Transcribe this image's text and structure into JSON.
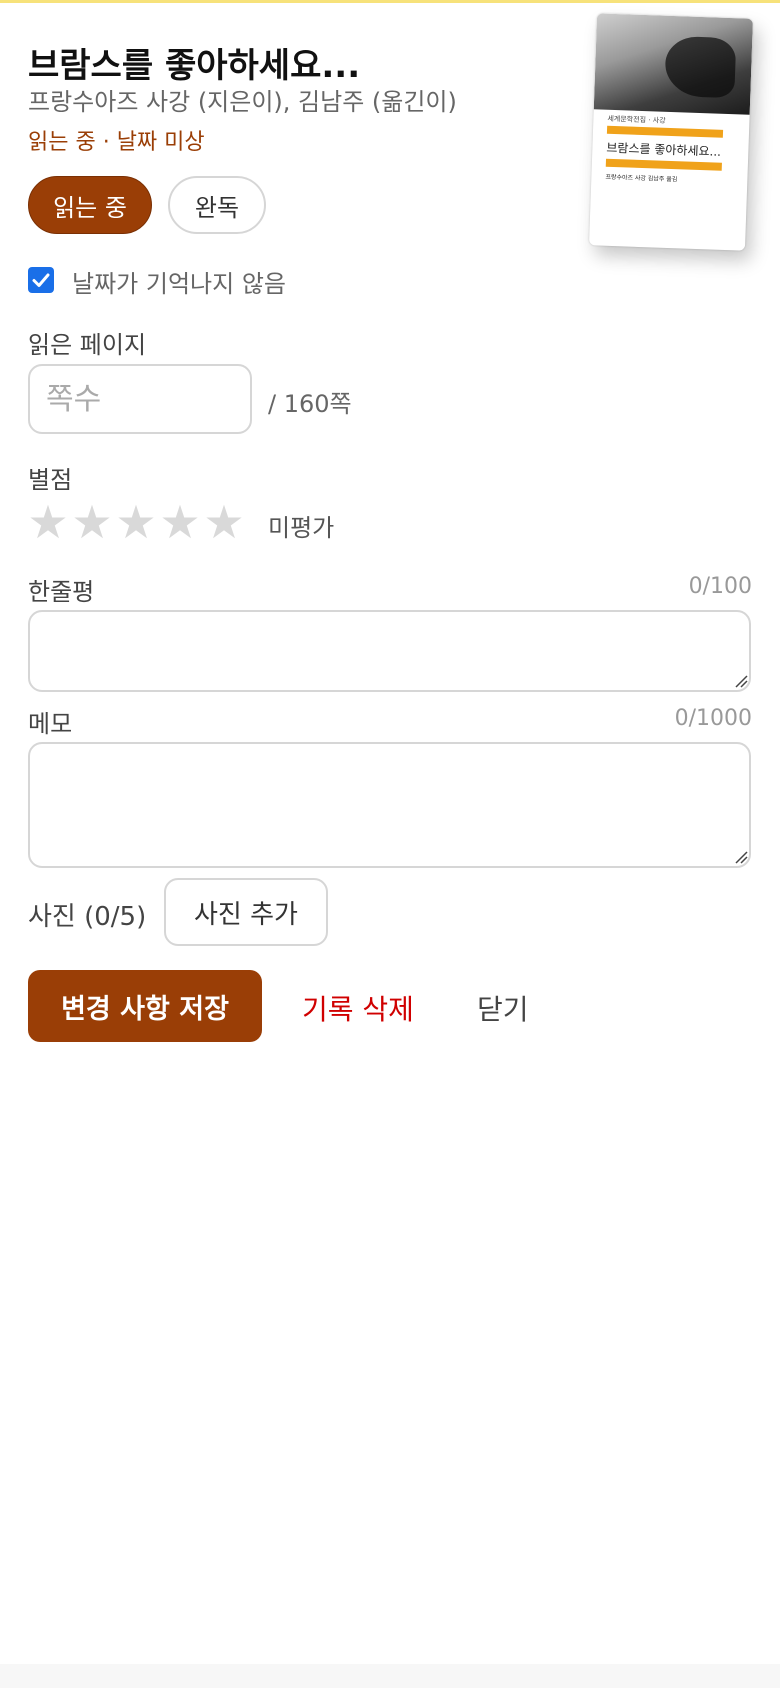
{
  "book": {
    "title": "브람스를 좋아하세요...",
    "authors": "프랑수아즈 사강 (지은이), 김남주 (옮긴이)",
    "status_line": "읽는 중 · 날짜 미상"
  },
  "cover": {
    "title": "브람스를 좋아하세요...",
    "series": "세계문학전집 · 사강",
    "author": "프랑수아즈 사강  김남주 옮김"
  },
  "status_buttons": {
    "reading": "읽는 중",
    "done": "완독",
    "selected": "reading"
  },
  "no_date": {
    "checked": true,
    "label": "날짜가 기억나지 않음"
  },
  "pages": {
    "label": "읽은 페이지",
    "placeholder": "쪽수",
    "value": "",
    "total": "/ 160쪽"
  },
  "rating": {
    "label": "별점",
    "value": 0,
    "max": 5,
    "text": "미평가"
  },
  "one_line_review": {
    "label": "한줄평",
    "counter": "0/100",
    "value": ""
  },
  "memo": {
    "label": "메모",
    "counter": "0/1000",
    "value": ""
  },
  "photos": {
    "label": "사진 (0/5)",
    "add_label": "사진 추가"
  },
  "actions": {
    "save": "변경 사항 저장",
    "delete": "기록 삭제",
    "close": "닫기"
  },
  "colors": {
    "accent": "#9a3e06",
    "danger": "#d00000",
    "checkbox": "#1a6fe8",
    "star_empty": "#d9d9d9",
    "top_border": "#f7e27a"
  }
}
